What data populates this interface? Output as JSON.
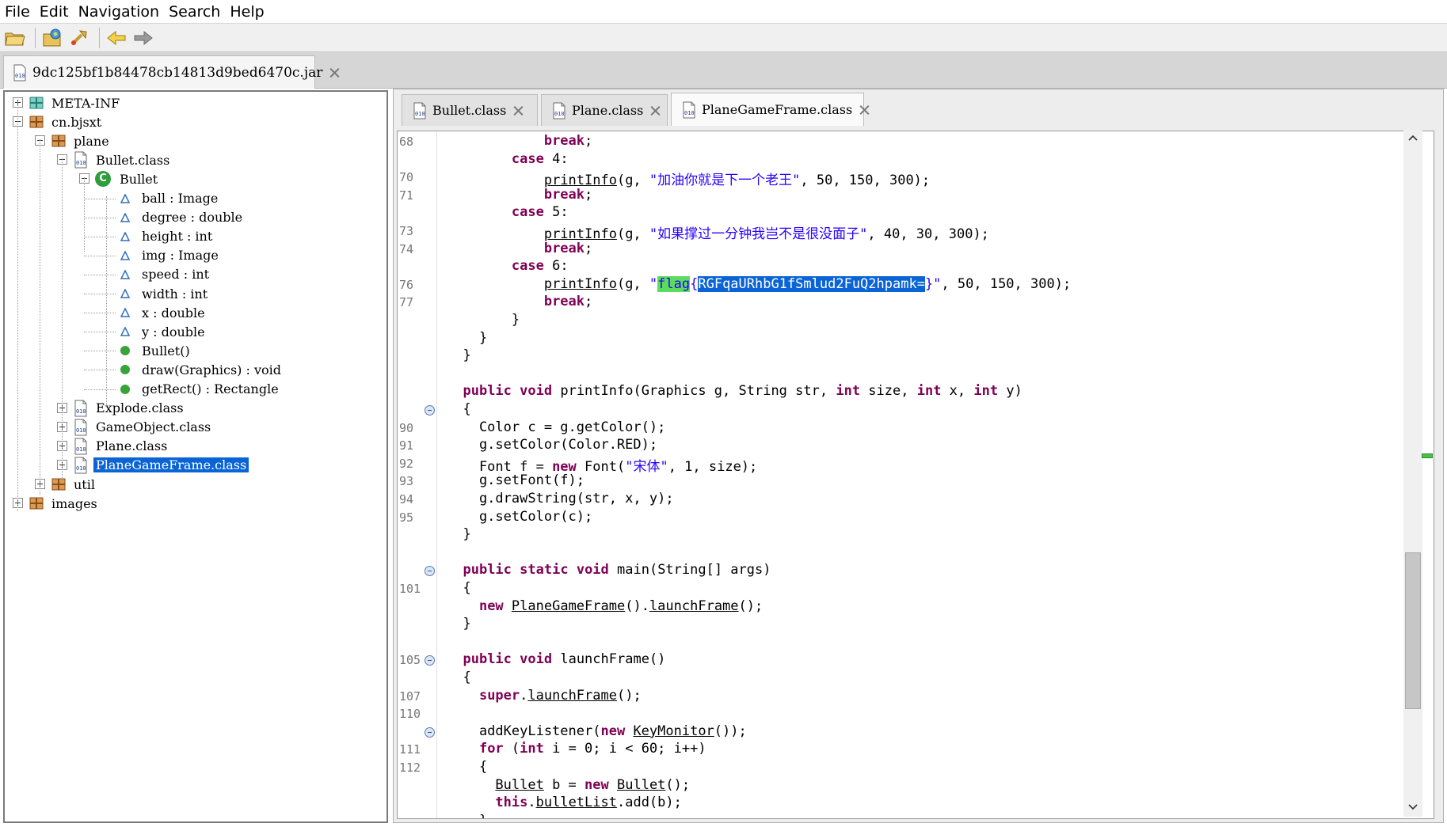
{
  "menu": [
    "File",
    "Edit",
    "Navigation",
    "Search",
    "Help"
  ],
  "toolbar": {
    "icons": [
      "open-folder-icon",
      "open-multi-icon",
      "go-icon",
      "back-arrow-icon",
      "forward-arrow-icon"
    ]
  },
  "file_tab": {
    "label": "9dc125bf1b84478cb14813d9bed6470c.jar"
  },
  "tree": {
    "nodes": [
      {
        "label": "META-INF",
        "icon": "package-icon",
        "toggle": "plus"
      },
      {
        "label": "cn.bjsxt",
        "icon": "package-icon",
        "toggle": "minus"
      },
      {
        "label": "plane",
        "icon": "package-icon",
        "toggle": "minus"
      },
      {
        "label": "Bullet.class",
        "icon": "class-file-icon",
        "toggle": "minus"
      },
      {
        "label": "Bullet",
        "icon": "class-icon",
        "toggle": "minus"
      },
      {
        "label": "ball : Image",
        "icon": "field-icon"
      },
      {
        "label": "degree : double",
        "icon": "field-icon"
      },
      {
        "label": "height : int",
        "icon": "field-icon"
      },
      {
        "label": "img : Image",
        "icon": "field-icon"
      },
      {
        "label": "speed : int",
        "icon": "field-icon"
      },
      {
        "label": "width : int",
        "icon": "field-icon"
      },
      {
        "label": "x : double",
        "icon": "field-icon"
      },
      {
        "label": "y : double",
        "icon": "field-icon"
      },
      {
        "label": "Bullet()",
        "icon": "method-icon"
      },
      {
        "label": "draw(Graphics) : void",
        "icon": "method-icon"
      },
      {
        "label": "getRect() : Rectangle",
        "icon": "method-icon"
      },
      {
        "label": "Explode.class",
        "icon": "class-file-icon",
        "toggle": "plus"
      },
      {
        "label": "GameObject.class",
        "icon": "class-file-icon",
        "toggle": "plus"
      },
      {
        "label": "Plane.class",
        "icon": "class-file-icon",
        "toggle": "plus"
      },
      {
        "label": "PlaneGameFrame.class",
        "icon": "class-file-icon",
        "toggle": "plus",
        "selected": true
      },
      {
        "label": "util",
        "icon": "package-icon",
        "toggle": "plus"
      },
      {
        "label": "images",
        "icon": "package-icon",
        "toggle": "plus"
      }
    ]
  },
  "editor_tabs": [
    {
      "label": "Bullet.class",
      "active": false
    },
    {
      "label": "Plane.class",
      "active": false
    },
    {
      "label": "PlaneGameFrame.class",
      "active": true
    }
  ],
  "code": {
    "line_numbers": [
      "68",
      "",
      "70",
      "71",
      "",
      "73",
      "74",
      "",
      "76",
      "77",
      "",
      "",
      "",
      "",
      "",
      "",
      "90",
      "91",
      "92",
      "93",
      "94",
      "95",
      "",
      "",
      "",
      "101",
      "",
      "",
      "",
      "105",
      "",
      "107",
      "110",
      "",
      "111",
      "112"
    ],
    "fold_lines": [
      15,
      24,
      29,
      33
    ],
    "lines": [
      [
        [
          "            ",
          ""
        ],
        [
          "break",
          "kw"
        ],
        [
          ";",
          ""
        ]
      ],
      [
        [
          "        ",
          ""
        ],
        [
          "case",
          "kw"
        ],
        [
          " 4:",
          ""
        ]
      ],
      [
        [
          "            ",
          ""
        ],
        [
          "printInfo",
          "u"
        ],
        [
          "(g, ",
          ""
        ],
        [
          "\"加油你就是下一个老王\"",
          "str"
        ],
        [
          ", 50, 150, 300);",
          ""
        ]
      ],
      [
        [
          "            ",
          ""
        ],
        [
          "break",
          "kw"
        ],
        [
          ";",
          ""
        ]
      ],
      [
        [
          "        ",
          ""
        ],
        [
          "case",
          "kw"
        ],
        [
          " 5:",
          ""
        ]
      ],
      [
        [
          "            ",
          ""
        ],
        [
          "printInfo",
          "u"
        ],
        [
          "(g, ",
          ""
        ],
        [
          "\"如果撑过一分钟我岂不是很没面子\"",
          "str"
        ],
        [
          ", 40, 30, 300);",
          ""
        ]
      ],
      [
        [
          "            ",
          ""
        ],
        [
          "break",
          "kw"
        ],
        [
          ";",
          ""
        ]
      ],
      [
        [
          "        ",
          ""
        ],
        [
          "case",
          "kw"
        ],
        [
          " 6:",
          ""
        ]
      ],
      [
        [
          "            ",
          ""
        ],
        [
          "printInfo",
          "u"
        ],
        [
          "(g, ",
          ""
        ],
        [
          "\"",
          "str"
        ],
        [
          "flag",
          "str hl-green"
        ],
        [
          "{",
          "str"
        ],
        [
          "RGFqaURhbG1fSmlud2FuQ2hpamk=",
          "hl-blue"
        ],
        [
          "}\"",
          "str"
        ],
        [
          ", 50, 150, 300);",
          ""
        ]
      ],
      [
        [
          "            ",
          ""
        ],
        [
          "break",
          "kw"
        ],
        [
          ";",
          ""
        ]
      ],
      [
        [
          "        }",
          ""
        ]
      ],
      [
        [
          "    }",
          ""
        ]
      ],
      [
        [
          "  }",
          ""
        ]
      ],
      [
        [
          "",
          ""
        ]
      ],
      [
        [
          "  ",
          ""
        ],
        [
          "public",
          "kw"
        ],
        [
          " ",
          ""
        ],
        [
          "void",
          "kw"
        ],
        [
          " printInfo(Graphics g, String str, ",
          ""
        ],
        [
          "int",
          "kw"
        ],
        [
          " size, ",
          ""
        ],
        [
          "int",
          "kw"
        ],
        [
          " x, ",
          ""
        ],
        [
          "int",
          "kw"
        ],
        [
          " y)",
          ""
        ]
      ],
      [
        [
          "  {",
          ""
        ]
      ],
      [
        [
          "    Color c = g.getColor();",
          ""
        ]
      ],
      [
        [
          "    g.setColor(Color.RED);",
          ""
        ]
      ],
      [
        [
          "    Font f = ",
          ""
        ],
        [
          "new",
          "kw"
        ],
        [
          " Font(",
          ""
        ],
        [
          "\"宋体\"",
          "str"
        ],
        [
          ", 1, size);",
          ""
        ]
      ],
      [
        [
          "    g.setFont(f);",
          ""
        ]
      ],
      [
        [
          "    g.drawString(str, x, y);",
          ""
        ]
      ],
      [
        [
          "    g.setColor(c);",
          ""
        ]
      ],
      [
        [
          "  }",
          ""
        ]
      ],
      [
        [
          "",
          ""
        ]
      ],
      [
        [
          "  ",
          ""
        ],
        [
          "public",
          "kw"
        ],
        [
          " ",
          ""
        ],
        [
          "static",
          "kw"
        ],
        [
          " ",
          ""
        ],
        [
          "void",
          "kw"
        ],
        [
          " main(String[] args)",
          ""
        ]
      ],
      [
        [
          "  {",
          ""
        ]
      ],
      [
        [
          "    ",
          ""
        ],
        [
          "new",
          "kw"
        ],
        [
          " ",
          ""
        ],
        [
          "PlaneGameFrame",
          "u"
        ],
        [
          "().",
          ""
        ],
        [
          "launchFrame",
          "u"
        ],
        [
          "();",
          ""
        ]
      ],
      [
        [
          "  }",
          ""
        ]
      ],
      [
        [
          "",
          ""
        ]
      ],
      [
        [
          "  ",
          ""
        ],
        [
          "public",
          "kw"
        ],
        [
          " ",
          ""
        ],
        [
          "void",
          "kw"
        ],
        [
          " launchFrame()",
          ""
        ]
      ],
      [
        [
          "  {",
          ""
        ]
      ],
      [
        [
          "    ",
          ""
        ],
        [
          "super",
          "kw"
        ],
        [
          ".",
          ""
        ],
        [
          "launchFrame",
          "u"
        ],
        [
          "();",
          ""
        ]
      ],
      [
        [
          "",
          ""
        ]
      ],
      [
        [
          "    addKeyListener(",
          ""
        ],
        [
          "new",
          "kw"
        ],
        [
          " ",
          ""
        ],
        [
          "KeyMonitor",
          "u"
        ],
        [
          "());",
          ""
        ]
      ],
      [
        [
          "    ",
          ""
        ],
        [
          "for",
          "kw"
        ],
        [
          " (",
          ""
        ],
        [
          "int",
          "kw"
        ],
        [
          " i = 0; i < 60; i++)",
          ""
        ]
      ],
      [
        [
          "    {",
          ""
        ]
      ],
      [
        [
          "      ",
          ""
        ],
        [
          "Bullet",
          "u"
        ],
        [
          " b = ",
          ""
        ],
        [
          "new",
          "kw"
        ],
        [
          " ",
          ""
        ],
        [
          "Bullet",
          "u"
        ],
        [
          "();",
          ""
        ]
      ],
      [
        [
          "      ",
          ""
        ],
        [
          "this",
          "kw"
        ],
        [
          ".",
          ""
        ],
        [
          "bulletList",
          "u"
        ],
        [
          ".add(b);",
          ""
        ]
      ],
      [
        [
          "    }",
          ""
        ]
      ]
    ]
  }
}
